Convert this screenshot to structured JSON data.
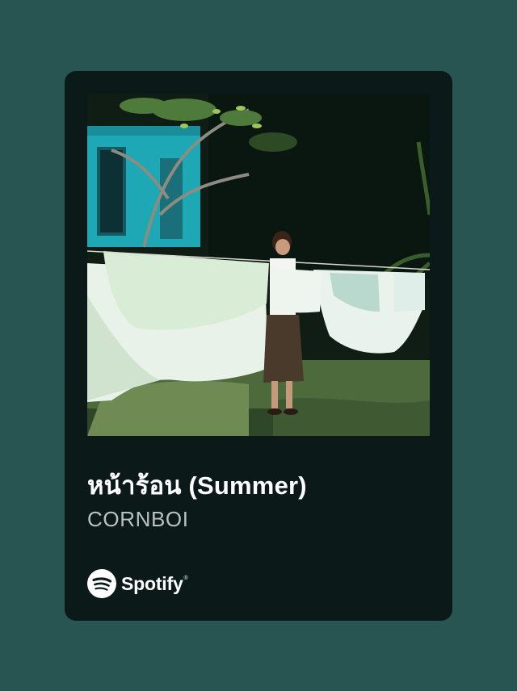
{
  "track": {
    "title": "หน้าร้อน (Summer)",
    "artist": "CORNBOI"
  },
  "brand": {
    "name": "Spotify",
    "reg_mark": "®",
    "icon": "spotify-logo-icon"
  },
  "cover_art": {
    "description_icon": "album-cover-photo"
  },
  "colors": {
    "background": "#285552",
    "card": "#0b1a19",
    "title": "#ffffff",
    "artist": "#b9c2c1"
  }
}
